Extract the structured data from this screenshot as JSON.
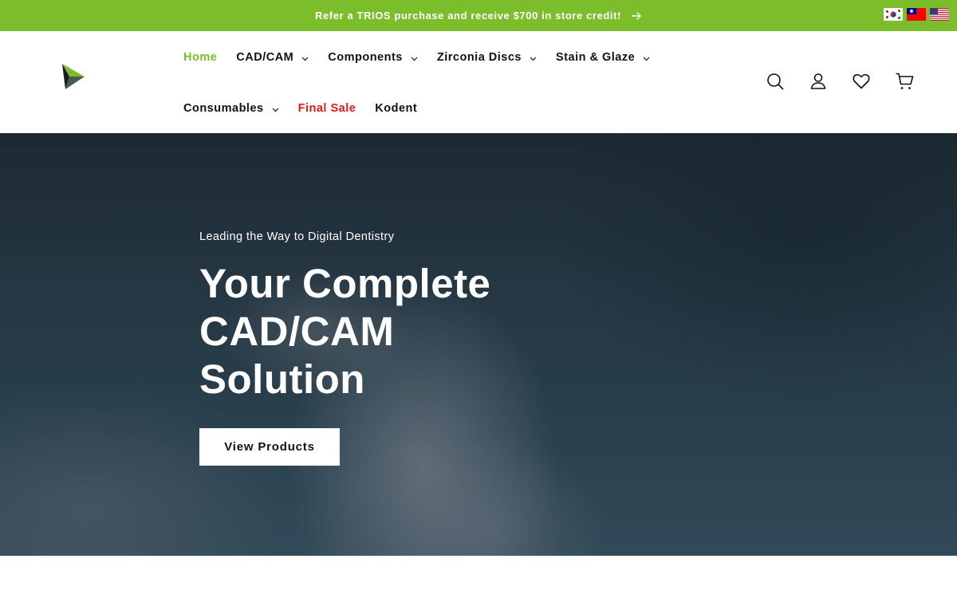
{
  "announcement": {
    "text": "Refer a TRIOS purchase and receive $700 in store credit!",
    "arrow_icon": "arrow-right-icon",
    "background_color": "#7bbd2a"
  },
  "languages": [
    {
      "name": "korea-flag-icon"
    },
    {
      "name": "taiwan-flag-icon"
    },
    {
      "name": "usa-flag-icon"
    }
  ],
  "header": {
    "logo_icon": "triangle-logo-icon",
    "nav_row1": [
      {
        "label": "Home",
        "active": true,
        "dropdown": false
      },
      {
        "label": "CAD/CAM",
        "dropdown": true
      },
      {
        "label": "Components",
        "dropdown": true
      },
      {
        "label": "Zirconia Discs",
        "dropdown": true
      },
      {
        "label": "Stain & Glaze",
        "dropdown": true
      }
    ],
    "nav_row2": [
      {
        "label": "Consumables",
        "dropdown": true
      },
      {
        "label": "Final Sale",
        "highlight_color": "#e0191b"
      },
      {
        "label": "Kodent"
      }
    ],
    "icons": [
      "search-icon",
      "account-icon",
      "wishlist-heart-icon",
      "cart-icon"
    ],
    "active_color": "#7bbd2a"
  },
  "hero": {
    "eyebrow": "Leading the Way to Digital Dentistry",
    "title_line1": "Your Complete",
    "title_line2": "CAD/CAM",
    "title_line3": "Solution",
    "button_label": "View Products"
  }
}
